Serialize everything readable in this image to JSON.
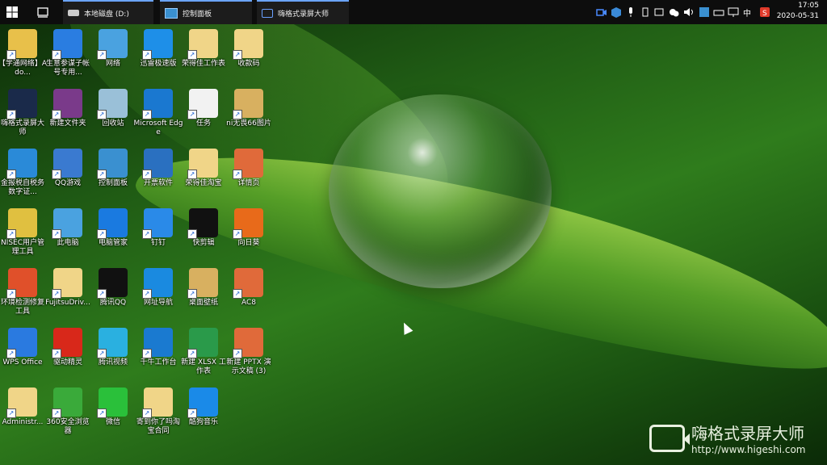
{
  "taskbar": {
    "tasks": [
      {
        "label": "本地磁盘 (D:)",
        "icon": "drive-icon"
      },
      {
        "label": "控制面板",
        "icon": "control-panel-icon"
      },
      {
        "label": "嗨格式录屏大师",
        "icon": "camera-icon"
      }
    ],
    "ime_label": "中",
    "clock_time": "17:05",
    "clock_date": "2020-05-31"
  },
  "desktop": {
    "icons": [
      {
        "label": "【学通网络】Ado...",
        "icon": "pdf-folder-icon",
        "color": "#e8c04a"
      },
      {
        "label": "生意参谋子帐号专用...",
        "icon": "compass-icon",
        "color": "#2a7de1"
      },
      {
        "label": "网络",
        "icon": "network-icon",
        "color": "#4aa2e0"
      },
      {
        "label": "迅雷极速版",
        "icon": "thunder-icon",
        "color": "#1e8fe8"
      },
      {
        "label": "荣得佳工作表",
        "icon": "folder-icon",
        "color": "#f0d588"
      },
      {
        "label": "收款码",
        "icon": "folder-icon",
        "color": "#f0d588"
      },
      {
        "label": "嗨格式录屏大师",
        "icon": "camera-icon",
        "color": "#1a2a4a"
      },
      {
        "label": "新建文件夹",
        "icon": "winrar-icon",
        "color": "#7a3a8a"
      },
      {
        "label": "回收站",
        "icon": "recycle-bin-icon",
        "color": "#9ac0d8"
      },
      {
        "label": "Microsoft Edge",
        "icon": "edge-icon",
        "color": "#1a78d0"
      },
      {
        "label": "任务",
        "icon": "document-icon",
        "color": "#f2f2f2"
      },
      {
        "label": "ni无畏66图片",
        "icon": "folder-icon",
        "color": "#d8b060"
      },
      {
        "label": "金报税自税务数字证...",
        "icon": "tax-icon",
        "color": "#2a8ad8"
      },
      {
        "label": "QQ游戏",
        "icon": "qq-game-icon",
        "color": "#3a7ad0"
      },
      {
        "label": "控制面板",
        "icon": "control-panel-icon",
        "color": "#3a90d0"
      },
      {
        "label": "开票软件",
        "icon": "invoice-icon",
        "color": "#2a70c0"
      },
      {
        "label": "荣得佳淘宝",
        "icon": "folder-icon",
        "color": "#f0d588"
      },
      {
        "label": "详情页",
        "icon": "ppt-icon",
        "color": "#e06a3a"
      },
      {
        "label": "NISEC用户管理工具",
        "icon": "nisec-icon",
        "color": "#e0c040"
      },
      {
        "label": "此电脑",
        "icon": "computer-icon",
        "color": "#4aa2e0"
      },
      {
        "label": "电脑管家",
        "icon": "shield-icon",
        "color": "#1a7ae0"
      },
      {
        "label": "钉钉",
        "icon": "dingtalk-icon",
        "color": "#2a8ae8"
      },
      {
        "label": "快剪辑",
        "icon": "video-edit-icon",
        "color": "#111111"
      },
      {
        "label": "向日葵",
        "icon": "sunflower-icon",
        "color": "#e86a1a"
      },
      {
        "label": "环境检测修复工具",
        "icon": "repair-icon",
        "color": "#e0502a"
      },
      {
        "label": "FujitsuDriv...",
        "icon": "folder-icon",
        "color": "#f0d588"
      },
      {
        "label": "腾讯QQ",
        "icon": "qq-icon",
        "color": "#111111"
      },
      {
        "label": "网址导航",
        "icon": "ie-icon",
        "color": "#1a8ae0"
      },
      {
        "label": "桌面壁纸",
        "icon": "folder-icon",
        "color": "#d8b060"
      },
      {
        "label": "AC8",
        "icon": "ppt-icon",
        "color": "#e06a3a"
      },
      {
        "label": "WPS Office",
        "icon": "wps-icon",
        "color": "#2a7ae0"
      },
      {
        "label": "驱动精灵",
        "icon": "driver-icon",
        "color": "#d8281a"
      },
      {
        "label": "腾讯视频",
        "icon": "video-icon",
        "color": "#2ab0e0"
      },
      {
        "label": "千牛工作台",
        "icon": "qianniu-icon",
        "color": "#1a7ad0"
      },
      {
        "label": "新建 XLSX 工作表",
        "icon": "xlsx-icon",
        "color": "#2a9a4a"
      },
      {
        "label": "新建 PPTX 演示文稿 (3)",
        "icon": "ppt-icon",
        "color": "#e06a3a"
      },
      {
        "label": "Administr...",
        "icon": "user-folder-icon",
        "color": "#f0d588"
      },
      {
        "label": "360安全浏览器",
        "icon": "browser-360-icon",
        "color": "#3aaa3a"
      },
      {
        "label": "微信",
        "icon": "wechat-icon",
        "color": "#2ac03a"
      },
      {
        "label": "寄到你了吗淘宝合同",
        "icon": "folder-icon",
        "color": "#f0d588"
      },
      {
        "label": "酷狗音乐",
        "icon": "kugou-icon",
        "color": "#1a8ae8"
      }
    ]
  },
  "watermark": {
    "title": "嗨格式录屏大师",
    "url": "http://www.higeshi.com"
  }
}
